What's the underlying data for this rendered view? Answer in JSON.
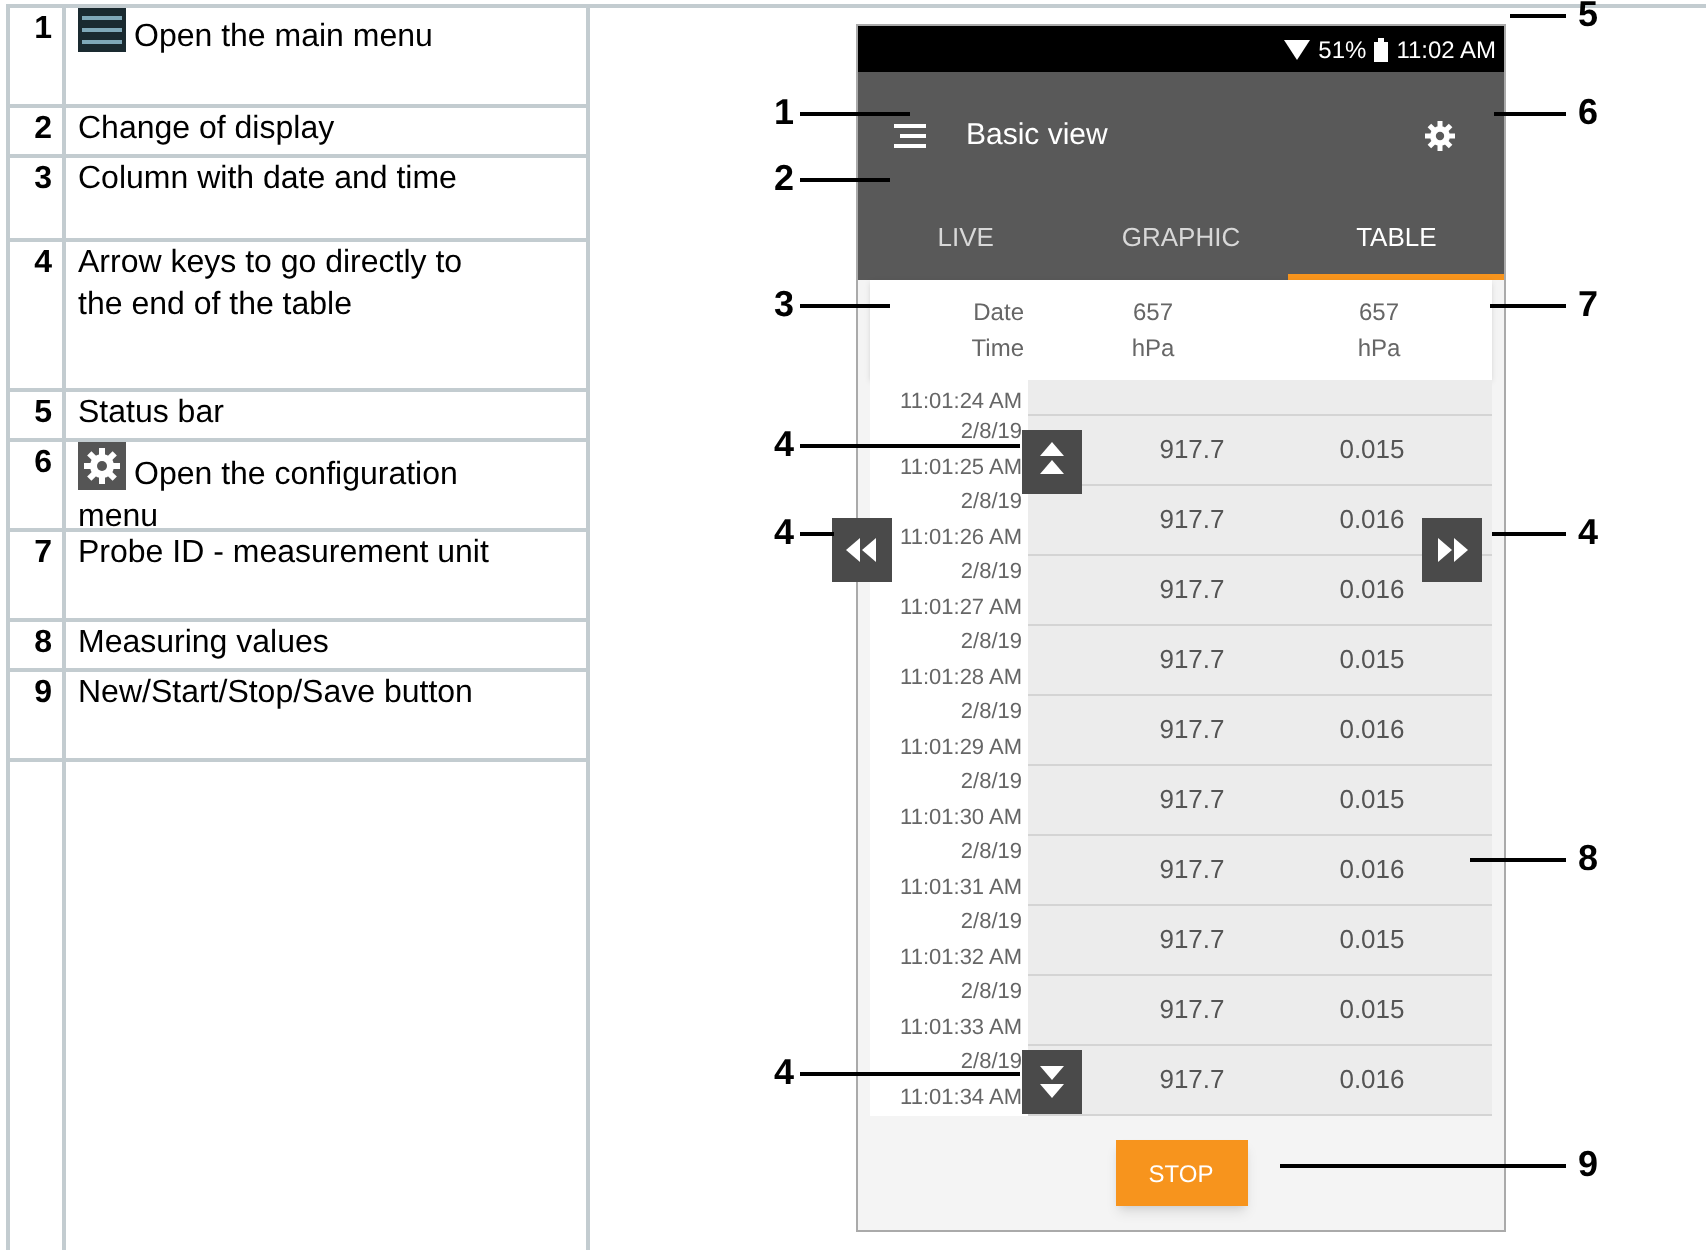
{
  "legend": [
    {
      "number": "1",
      "kind": "menu",
      "text": "Open the main menu"
    },
    {
      "number": "2",
      "kind": "plain",
      "text": "Change of display"
    },
    {
      "number": "3",
      "kind": "plain",
      "text": "Column with date and time"
    },
    {
      "number": "4",
      "kind": "plain",
      "text": "Arrow keys to go directly to the end of the table"
    },
    {
      "number": "5",
      "kind": "plain",
      "text": "Status bar"
    },
    {
      "number": "6",
      "kind": "settings",
      "text": "Open the configuration menu"
    },
    {
      "number": "7",
      "kind": "plain",
      "text": "Probe ID - measurement unit"
    },
    {
      "number": "8",
      "kind": "plain",
      "text": "Measuring values"
    },
    {
      "number": "9",
      "kind": "plain",
      "text": "New/Start/Stop/Save button"
    }
  ],
  "screen": {
    "status_bar": {
      "battery": "51%",
      "time": "11:02 AM"
    },
    "app_bar": {
      "title": "Basic view"
    },
    "tabs": [
      {
        "label": "LIVE",
        "selected": false
      },
      {
        "label": "GRAPHIC",
        "selected": false
      },
      {
        "label": "TABLE",
        "selected": true
      }
    ],
    "table": {
      "columns": [
        {
          "line1": "Date",
          "line2": "Time"
        },
        {
          "line1": "657",
          "line2": "hPa"
        },
        {
          "line1": "657",
          "line2": "hPa"
        }
      ],
      "partial_row_time": "11:01:24 AM",
      "rows": [
        {
          "date": "2/8/19",
          "time": "11:01:25 AM",
          "values": [
            "917.7",
            "0.015"
          ]
        },
        {
          "date": "2/8/19",
          "time": "11:01:26 AM",
          "values": [
            "917.7",
            "0.016"
          ]
        },
        {
          "date": "2/8/19",
          "time": "11:01:27 AM",
          "values": [
            "917.7",
            "0.016"
          ]
        },
        {
          "date": "2/8/19",
          "time": "11:01:28 AM",
          "values": [
            "917.7",
            "0.015"
          ]
        },
        {
          "date": "2/8/19",
          "time": "11:01:29 AM",
          "values": [
            "917.7",
            "0.016"
          ]
        },
        {
          "date": "2/8/19",
          "time": "11:01:30 AM",
          "values": [
            "917.7",
            "0.015"
          ]
        },
        {
          "date": "2/8/19",
          "time": "11:01:31 AM",
          "values": [
            "917.7",
            "0.016"
          ]
        },
        {
          "date": "2/8/19",
          "time": "11:01:32 AM",
          "values": [
            "917.7",
            "0.015"
          ]
        },
        {
          "date": "2/8/19",
          "time": "11:01:33 AM",
          "values": [
            "917.7",
            "0.015"
          ]
        },
        {
          "date": "2/8/19",
          "time": "11:01:34 AM",
          "values": [
            "917.7",
            "0.016"
          ]
        }
      ]
    },
    "stop_button": "STOP"
  },
  "callouts": [
    {
      "number": "1"
    },
    {
      "number": "2"
    },
    {
      "number": "3"
    },
    {
      "number": "4"
    },
    {
      "number": "4"
    },
    {
      "number": "4"
    },
    {
      "number": "5"
    },
    {
      "number": "6"
    },
    {
      "number": "7"
    },
    {
      "number": "4"
    },
    {
      "number": "8"
    },
    {
      "number": "9"
    }
  ]
}
